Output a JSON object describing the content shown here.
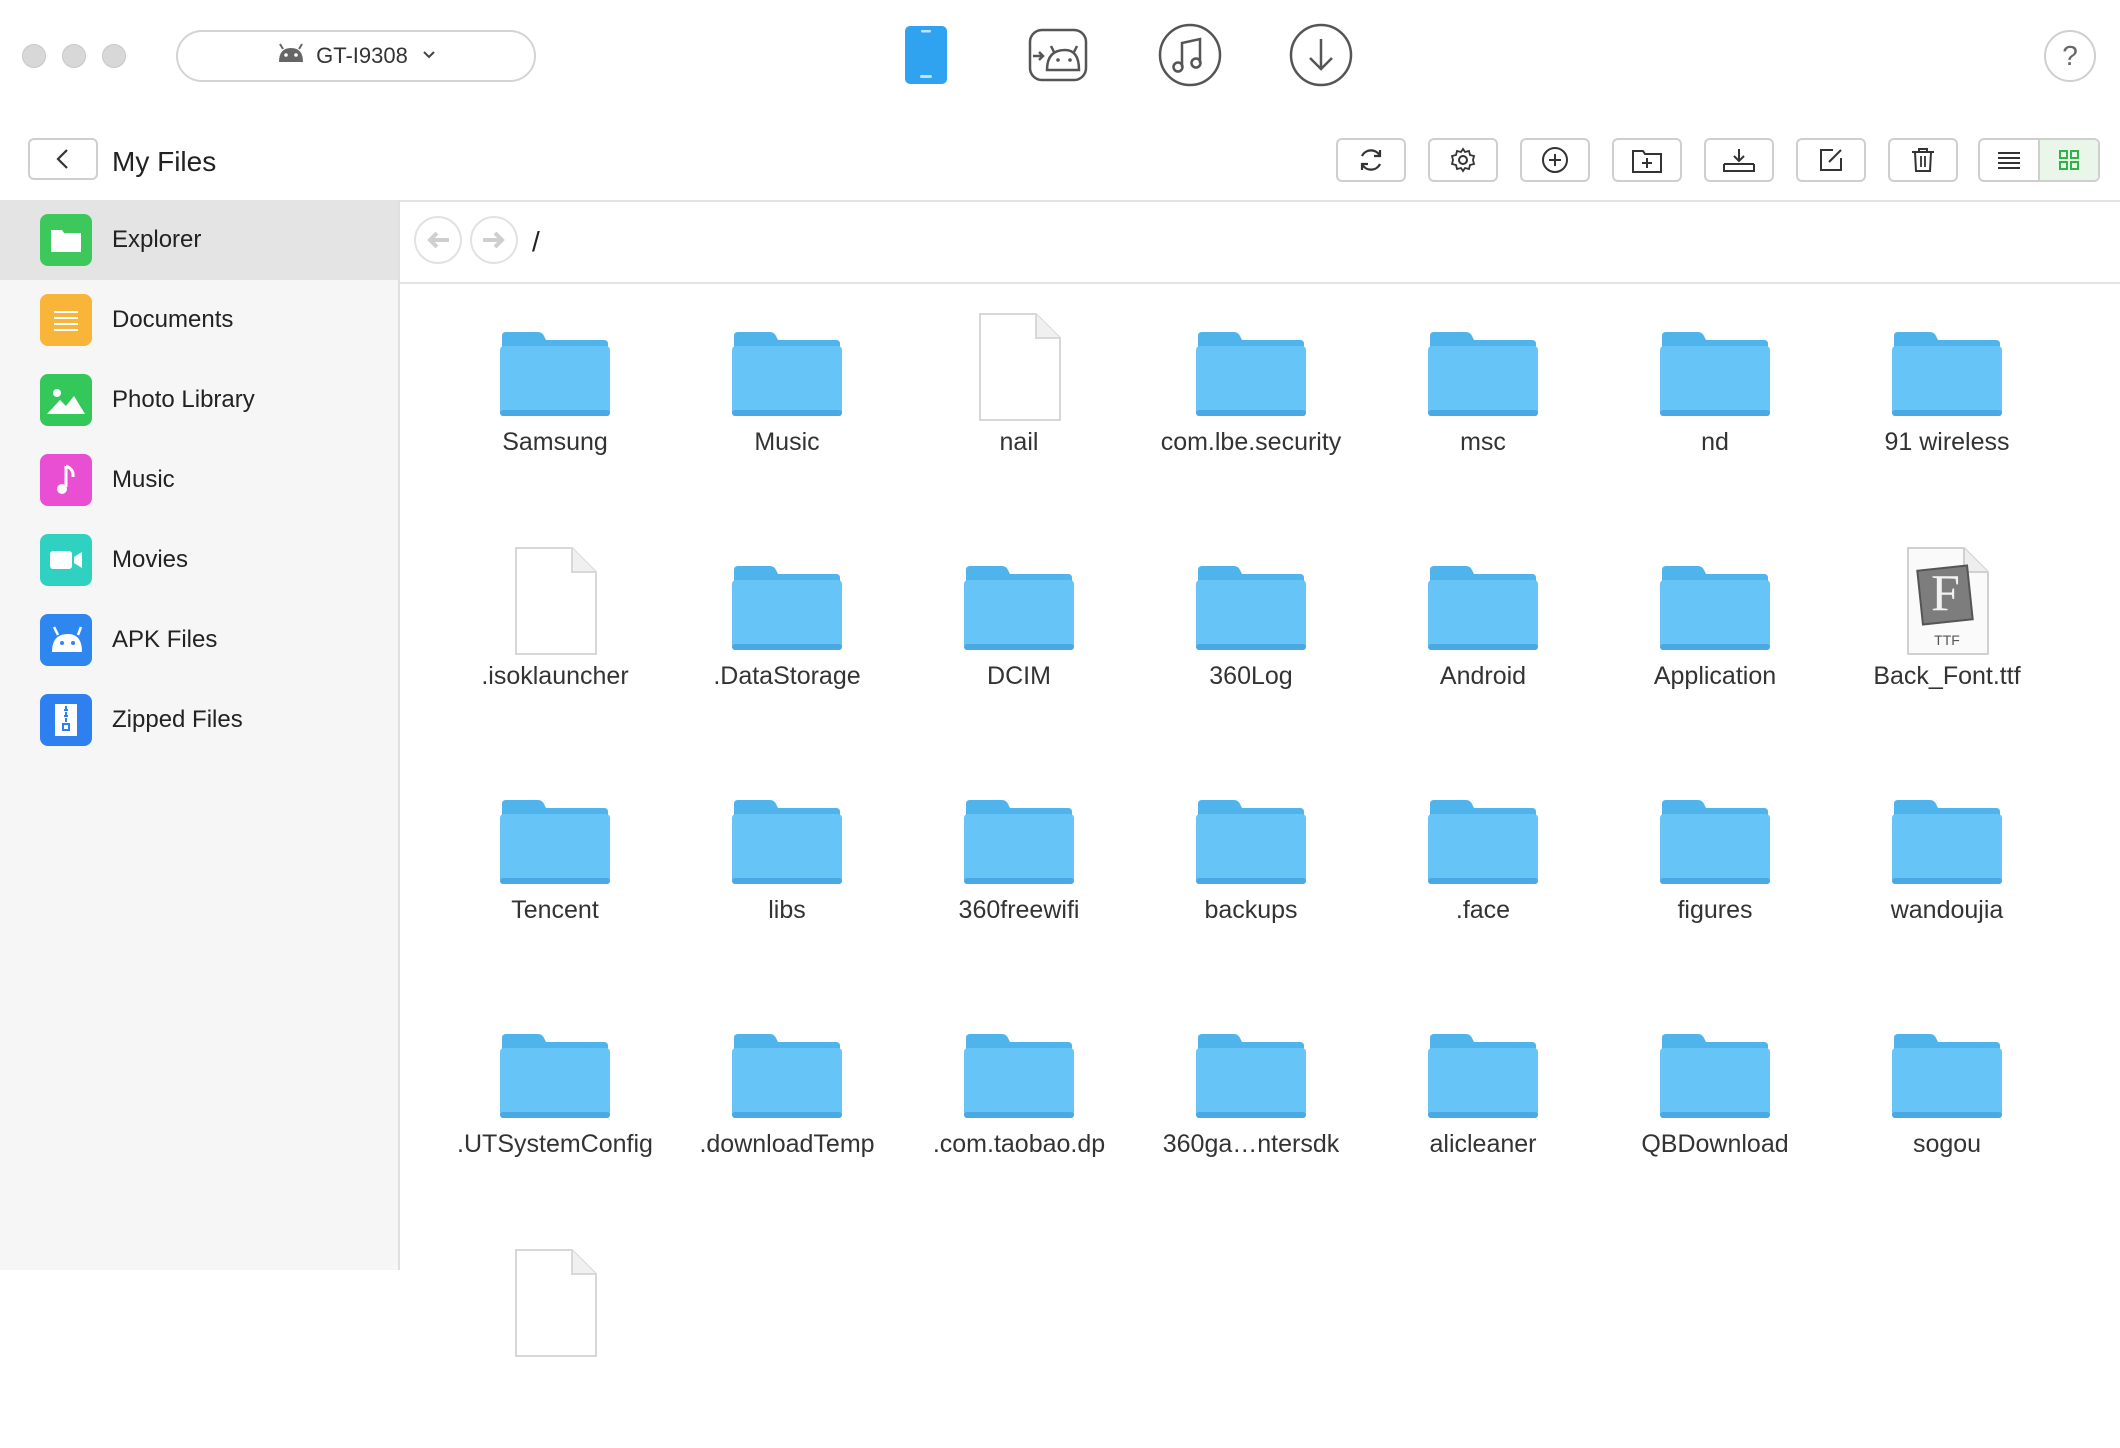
{
  "window": {
    "device_name": "GT-I9308"
  },
  "mode_tabs": [
    {
      "name": "phone-icon"
    },
    {
      "name": "android-transfer-icon"
    },
    {
      "name": "music-icon"
    },
    {
      "name": "download-icon"
    }
  ],
  "help_label": "?",
  "header": {
    "title": "My Files"
  },
  "toolbar": [
    {
      "name": "refresh-button",
      "icon": "refresh-icon"
    },
    {
      "name": "settings-button",
      "icon": "gear-icon"
    },
    {
      "name": "add-button",
      "icon": "plus-circle-icon"
    },
    {
      "name": "new-folder-button",
      "icon": "new-folder-icon"
    },
    {
      "name": "export-button",
      "icon": "export-icon"
    },
    {
      "name": "rename-button",
      "icon": "edit-icon"
    },
    {
      "name": "delete-button",
      "icon": "trash-icon"
    }
  ],
  "sidebar": {
    "items": [
      {
        "label": "Explorer",
        "icon": "folder-icon",
        "color": "#3cc85a",
        "active": true
      },
      {
        "label": "Documents",
        "icon": "documents-icon",
        "color": "#f8b53a",
        "active": false
      },
      {
        "label": "Photo Library",
        "icon": "photo-icon",
        "color": "#34c759",
        "active": false
      },
      {
        "label": "Music",
        "icon": "music-note-icon",
        "color": "#e84fd3",
        "active": false
      },
      {
        "label": "Movies",
        "icon": "video-camera-icon",
        "color": "#2fd1c0",
        "active": false
      },
      {
        "label": "APK Files",
        "icon": "android-icon",
        "color": "#2e86ef",
        "active": false
      },
      {
        "label": "Zipped Files",
        "icon": "zip-icon",
        "color": "#2e7ff0",
        "active": false
      }
    ]
  },
  "path": "/",
  "files": [
    {
      "name": "Samsung",
      "type": "folder"
    },
    {
      "name": "Music",
      "type": "folder"
    },
    {
      "name": "nail",
      "type": "file"
    },
    {
      "name": "com.lbe.security",
      "type": "folder"
    },
    {
      "name": "msc",
      "type": "folder"
    },
    {
      "name": "nd",
      "type": "folder"
    },
    {
      "name": "91 wireless",
      "type": "folder"
    },
    {
      "name": ".isoklauncher",
      "type": "file"
    },
    {
      "name": ".DataStorage",
      "type": "folder"
    },
    {
      "name": "DCIM",
      "type": "folder"
    },
    {
      "name": "360Log",
      "type": "folder"
    },
    {
      "name": "Android",
      "type": "folder"
    },
    {
      "name": "Application",
      "type": "folder"
    },
    {
      "name": "Back_Font.ttf",
      "type": "font",
      "badge": "TTF",
      "glyph": "F"
    },
    {
      "name": "Tencent",
      "type": "folder"
    },
    {
      "name": "libs",
      "type": "folder"
    },
    {
      "name": "360freewifi",
      "type": "folder"
    },
    {
      "name": "backups",
      "type": "folder"
    },
    {
      "name": ".face",
      "type": "folder"
    },
    {
      "name": "figures",
      "type": "folder"
    },
    {
      "name": "wandoujia",
      "type": "folder"
    },
    {
      "name": ".UTSystemConfig",
      "type": "folder"
    },
    {
      "name": ".downloadTemp",
      "type": "folder"
    },
    {
      "name": ".com.taobao.dp",
      "type": "folder"
    },
    {
      "name": "360ga…ntersdk",
      "type": "folder"
    },
    {
      "name": "alicleaner",
      "type": "folder"
    },
    {
      "name": "QBDownload",
      "type": "folder"
    },
    {
      "name": "sogou",
      "type": "folder"
    },
    {
      "name": "",
      "type": "file"
    }
  ],
  "colors": {
    "accent": "#34b24a",
    "folder": "#5fc1f5",
    "phone": "#2fa3f0"
  }
}
